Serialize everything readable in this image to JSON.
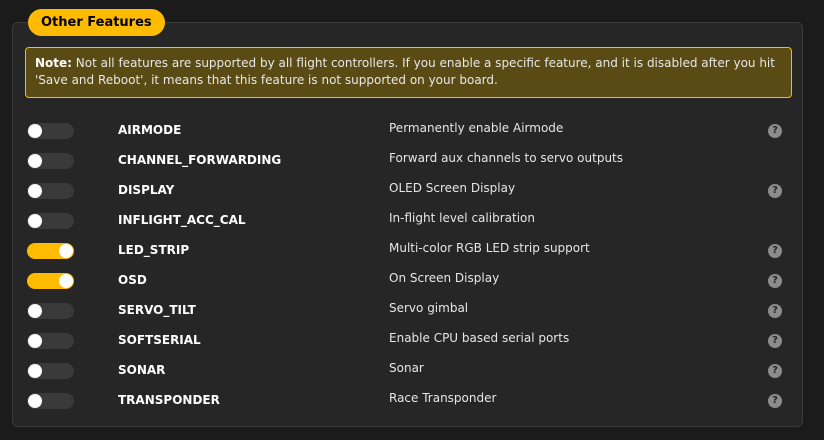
{
  "panel": {
    "title": "Other Features",
    "note_label": "Note:",
    "note_text": " Not all features are supported by all flight controllers. If you enable a specific feature, and it is disabled after you hit 'Save and Reboot', it means that this feature is not supported on your board."
  },
  "help_icon_glyph": "?",
  "colors": {
    "accent": "#ffbb00",
    "background": "#1b1b1b",
    "panel": "#262626",
    "toggle_off": "#3a3a3a"
  },
  "features": [
    {
      "name": "AIRMODE",
      "description": "Permanently enable Airmode",
      "enabled": false,
      "has_help": true
    },
    {
      "name": "CHANNEL_FORWARDING",
      "description": "Forward aux channels to servo outputs",
      "enabled": false,
      "has_help": false
    },
    {
      "name": "DISPLAY",
      "description": "OLED Screen Display",
      "enabled": false,
      "has_help": true
    },
    {
      "name": "INFLIGHT_ACC_CAL",
      "description": "In-flight level calibration",
      "enabled": false,
      "has_help": false
    },
    {
      "name": "LED_STRIP",
      "description": "Multi-color RGB LED strip support",
      "enabled": true,
      "has_help": true
    },
    {
      "name": "OSD",
      "description": "On Screen Display",
      "enabled": true,
      "has_help": true
    },
    {
      "name": "SERVO_TILT",
      "description": "Servo gimbal",
      "enabled": false,
      "has_help": true
    },
    {
      "name": "SOFTSERIAL",
      "description": "Enable CPU based serial ports",
      "enabled": false,
      "has_help": true
    },
    {
      "name": "SONAR",
      "description": "Sonar",
      "enabled": false,
      "has_help": true
    },
    {
      "name": "TRANSPONDER",
      "description": "Race Transponder",
      "enabled": false,
      "has_help": true
    }
  ]
}
